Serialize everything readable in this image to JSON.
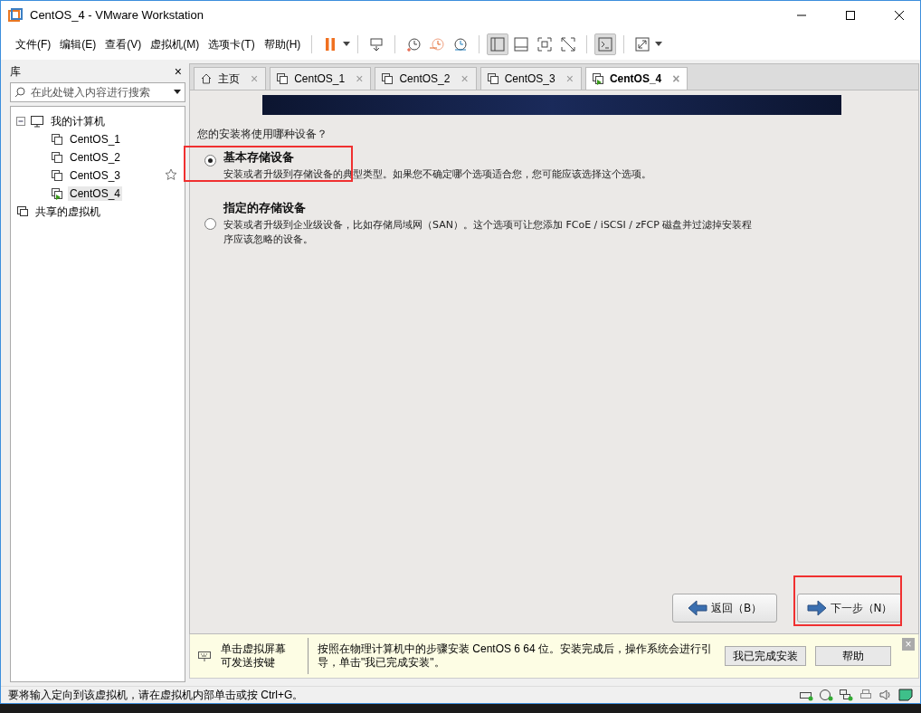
{
  "window": {
    "title": "CentOS_4 - VMware Workstation"
  },
  "menu": [
    "文件(F)",
    "编辑(E)",
    "查看(V)",
    "虚拟机(M)",
    "选项卡(T)",
    "帮助(H)"
  ],
  "library": {
    "title": "库",
    "close": "×",
    "search": {
      "placeholder": "在此处键入内容进行搜索"
    },
    "tree": [
      {
        "label": "我的计算机",
        "kind": "computer",
        "expanded": true,
        "children": [
          {
            "label": "CentOS_1",
            "kind": "vm",
            "running": false,
            "selected": false,
            "favorite": false
          },
          {
            "label": "CentOS_2",
            "kind": "vm",
            "running": false,
            "selected": false,
            "favorite": false
          },
          {
            "label": "CentOS_3",
            "kind": "vm",
            "running": false,
            "selected": false,
            "favorite": true
          },
          {
            "label": "CentOS_4",
            "kind": "vm",
            "running": true,
            "selected": true,
            "favorite": false
          }
        ]
      },
      {
        "label": "共享的虚拟机",
        "kind": "shared"
      }
    ]
  },
  "tabs": [
    {
      "label": "主页",
      "kind": "home",
      "selected": false,
      "close": "×"
    },
    {
      "label": "CentOS_1",
      "kind": "vm",
      "selected": false,
      "close": "×"
    },
    {
      "label": "CentOS_2",
      "kind": "vm",
      "selected": false,
      "close": "×"
    },
    {
      "label": "CentOS_3",
      "kind": "vm",
      "selected": false,
      "close": "×"
    },
    {
      "label": "CentOS_4",
      "kind": "vm",
      "selected": true,
      "close": "×"
    }
  ],
  "installer": {
    "question": "您的安装将使用哪种设备？",
    "options": [
      {
        "title": "基本存储设备",
        "description": "安装或者升级到存储设备的典型类型。如果您不确定哪个选项适合您，您可能应该选择这个选项。",
        "selected": true,
        "highlighted": true
      },
      {
        "title": "指定的存储设备",
        "description": "安装或者升级到企业级设备，比如存储局域网（SAN）。这个选项可让您添加 FCoE / iSCSI / zFCP 磁盘并过滤掉安装程序应该忽略的设备。",
        "selected": false,
        "highlighted": false
      }
    ],
    "buttons": [
      {
        "label": "返回（B）",
        "kind": "back",
        "highlighted": false
      },
      {
        "label": "下一步（N）",
        "kind": "next",
        "highlighted": true
      }
    ]
  },
  "hint_bar": {
    "keyboard_hint": "单击虚拟屏幕可发送按键",
    "message": "按照在物理计算机中的步骤安装 CentOS 6 64 位。安装完成后，操作系统会进行引导，单击\"我已完成安装\"。",
    "buttons": [
      "我已完成安装",
      "帮助"
    ],
    "close": "×"
  },
  "status_bar": {
    "text": "要将输入定向到该虚拟机，请在虚拟机内部单击或按 Ctrl+G。"
  }
}
